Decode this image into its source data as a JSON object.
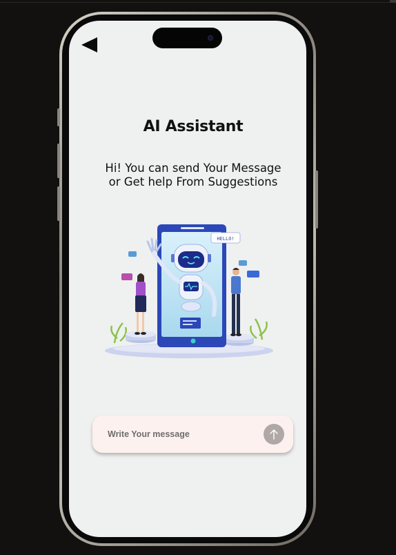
{
  "header": {
    "back_icon": "back-triangle-icon",
    "title": "AI Assistant"
  },
  "intro": {
    "message": "Hi! You can send Your Message or Get help From Suggestions"
  },
  "illustration": {
    "bubble_text": "HELLO!",
    "subject": "robot-chat-illustration"
  },
  "composer": {
    "placeholder": "Write Your message",
    "send_icon": "arrow-up-icon"
  },
  "colors": {
    "screen_bg": "#eff0f0",
    "composer_bg": "#fcf1ef",
    "send_button": "#b0a8a6",
    "accent_blue": "#3a5bd0"
  }
}
